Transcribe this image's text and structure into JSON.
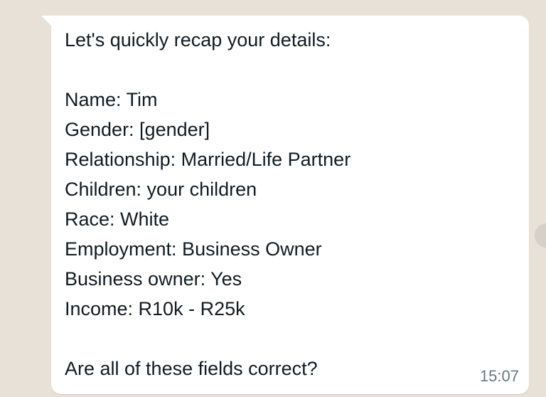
{
  "chat": {
    "message": {
      "text": "Let's quickly recap your details:\n\nName: Tim\nGender: [gender]\nRelationship: Married/Life Partner\nChildren: your children\nRace: White\nEmployment: Business Owner\nBusiness owner: Yes\nIncome: R10k - R25k\n\nAre all of these fields correct?",
      "time": "15:07"
    }
  }
}
